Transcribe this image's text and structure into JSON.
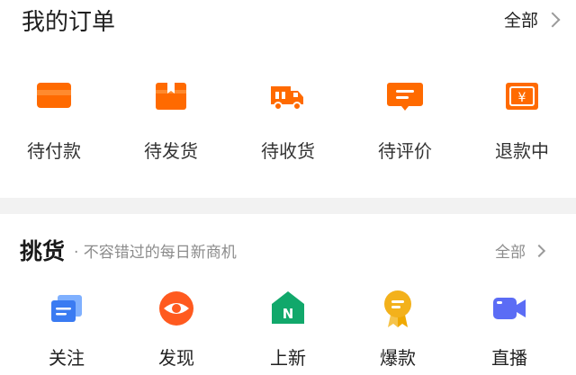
{
  "orders": {
    "title": "我的订单",
    "all_label": "全部",
    "items": [
      {
        "label": "待付款",
        "icon": "card-icon"
      },
      {
        "label": "待发货",
        "icon": "box-icon"
      },
      {
        "label": "待收货",
        "icon": "truck-icon"
      },
      {
        "label": "待评价",
        "icon": "comment-icon"
      },
      {
        "label": "退款中",
        "icon": "refund-icon"
      }
    ],
    "accent": "#ff6a00"
  },
  "picks": {
    "title": "挑货",
    "subtitle": "· 不容错过的每日新商机",
    "all_label": "全部",
    "items": [
      {
        "label": "关注",
        "icon": "follow-icon",
        "color": "#3a7bf2"
      },
      {
        "label": "发现",
        "icon": "eye-icon",
        "color": "#ff5a1f"
      },
      {
        "label": "上新",
        "icon": "new-house-icon",
        "color": "#11a86b"
      },
      {
        "label": "爆款",
        "icon": "medal-icon",
        "color": "#f3b11b"
      },
      {
        "label": "直播",
        "icon": "video-icon",
        "color": "#5b6cf5"
      }
    ]
  }
}
